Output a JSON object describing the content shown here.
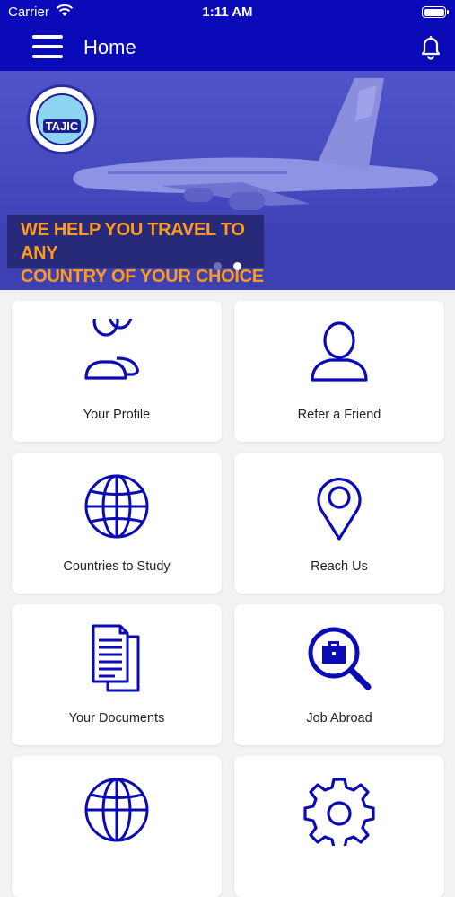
{
  "status_bar": {
    "carrier": "Carrier",
    "time": "1:11 AM"
  },
  "header": {
    "title": "Home",
    "menu_icon": "hamburger-menu-icon",
    "notification_icon": "bell-icon"
  },
  "banner": {
    "logo_text": "TAJIC",
    "caption_line1": "WE HELP YOU TRAVEL TO ANY",
    "caption_line2": "COUNTRY OF YOUR CHOICE",
    "slide_count": 2,
    "active_slide": 2
  },
  "tiles": [
    {
      "label": "Your Profile",
      "icon": "users-icon"
    },
    {
      "label": "Refer a Friend",
      "icon": "user-icon"
    },
    {
      "label": "Countries to Study",
      "icon": "globe-icon"
    },
    {
      "label": "Reach Us",
      "icon": "location-pin-icon"
    },
    {
      "label": "Your Documents",
      "icon": "documents-icon"
    },
    {
      "label": "Job Abroad",
      "icon": "job-search-icon"
    },
    {
      "label": "",
      "icon": "globe-icon"
    },
    {
      "label": "",
      "icon": "gear-icon"
    }
  ],
  "colors": {
    "primary": "#0a0ab8",
    "icon_stroke": "#0b0bb5",
    "caption_text": "#ff9a1f"
  }
}
